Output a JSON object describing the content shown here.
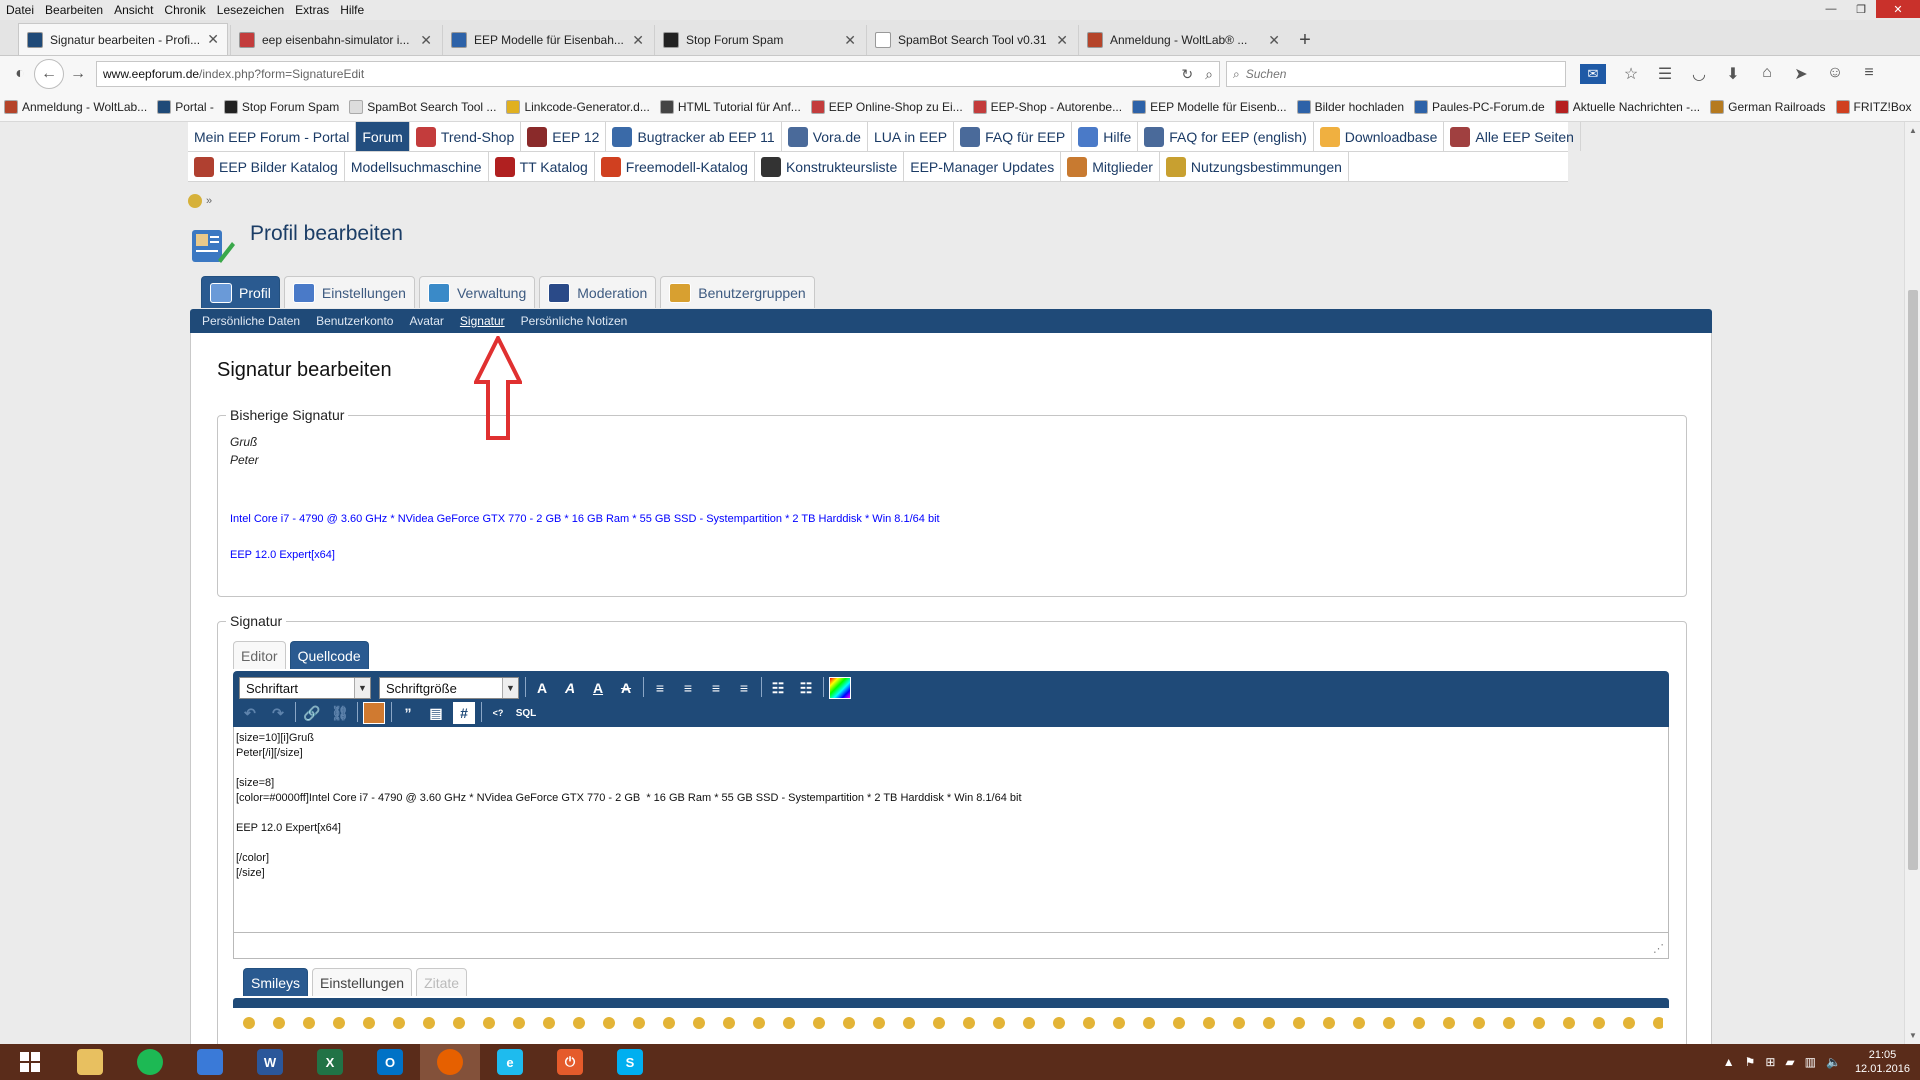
{
  "menubar": [
    "Datei",
    "Bearbeiten",
    "Ansicht",
    "Chronik",
    "Lesezeichen",
    "Extras",
    "Hilfe"
  ],
  "tabs": [
    {
      "title": "Signatur bearbeiten - Profi...",
      "color": "#1f4a78",
      "active": true
    },
    {
      "title": "eep eisenbahn-simulator i...",
      "color": "#c33c3c",
      "active": false
    },
    {
      "title": "EEP Modelle für Eisenbah...",
      "color": "#2d62a8",
      "active": false
    },
    {
      "title": "Stop Forum Spam",
      "color": "#222222",
      "active": false
    },
    {
      "title": "SpamBot Search Tool v0.31",
      "color": "#ffffff",
      "active": false
    },
    {
      "title": "Anmeldung - WoltLab® ...",
      "color": "#b5442a",
      "active": false
    }
  ],
  "url": {
    "host": "www.eepforum.de",
    "path": "/index.php?form=SignatureEdit"
  },
  "search_placeholder": "Suchen",
  "bookmarks": [
    {
      "label": "Anmeldung - WoltLab...",
      "color": "#b5442a"
    },
    {
      "label": "Portal -",
      "color": "#1f4a78"
    },
    {
      "label": "Stop Forum Spam",
      "color": "#222222"
    },
    {
      "label": "SpamBot Search Tool ...",
      "color": "#dddddd"
    },
    {
      "label": "Linkcode-Generator.d...",
      "color": "#e0b020"
    },
    {
      "label": "HTML Tutorial für Anf...",
      "color": "#444444"
    },
    {
      "label": "EEP Online-Shop zu Ei...",
      "color": "#c33c3c"
    },
    {
      "label": "EEP-Shop - Autorenbe...",
      "color": "#c33c3c"
    },
    {
      "label": "EEP Modelle für Eisenb...",
      "color": "#2d62a8"
    },
    {
      "label": "Bilder hochladen",
      "color": "#2d62a8"
    },
    {
      "label": "Paules-PC-Forum.de",
      "color": "#2d62a8"
    },
    {
      "label": "Aktuelle Nachrichten -...",
      "color": "#b52020"
    },
    {
      "label": "German Railroads",
      "color": "#b57a20"
    },
    {
      "label": "FRITZ!Box",
      "color": "#d04020"
    }
  ],
  "forumnav": {
    "row1": [
      {
        "label": "Mein EEP Forum - Portal",
        "icon": "",
        "active": false
      },
      {
        "label": "Forum",
        "icon": "",
        "active": true
      },
      {
        "label": "Trend-Shop",
        "icon": "#c33c3c",
        "active": false
      },
      {
        "label": "EEP 12",
        "icon": "#8a2a2a",
        "active": false
      },
      {
        "label": "Bugtracker ab EEP 11",
        "icon": "#3a6aa8",
        "active": false
      },
      {
        "label": "Vora.de",
        "icon": "#4a6a9a",
        "active": false
      },
      {
        "label": "LUA in EEP",
        "icon": "",
        "active": false
      },
      {
        "label": "FAQ für EEP",
        "icon": "#4a6a9a",
        "active": false
      },
      {
        "label": "Hilfe",
        "icon": "#4a7ac8",
        "active": false
      },
      {
        "label": "FAQ for EEP (english)",
        "icon": "#4a6a9a",
        "active": false
      },
      {
        "label": "Downloadbase",
        "icon": "#f0b040",
        "active": false
      },
      {
        "label": "Alle EEP Seiten",
        "icon": "#a04040",
        "active": false
      }
    ],
    "row2": [
      {
        "label": "EEP Bilder Katalog",
        "icon": "#b04030",
        "active": false
      },
      {
        "label": "Modellsuchmaschine",
        "icon": "",
        "active": false
      },
      {
        "label": "TT Katalog",
        "icon": "#b02020",
        "active": false
      },
      {
        "label": "Freemodell-Katalog",
        "icon": "#d04020",
        "active": false
      },
      {
        "label": "Konstrukteursliste",
        "icon": "#333333",
        "active": false
      },
      {
        "label": "EEP-Manager Updates",
        "icon": "",
        "active": false
      },
      {
        "label": "Mitglieder",
        "icon": "#c87a30",
        "active": false
      },
      {
        "label": "Nutzungsbestimmungen",
        "icon": "#c8a030",
        "active": false
      }
    ]
  },
  "page_title": "Profil bearbeiten",
  "profile_tabs": [
    {
      "label": "Profil",
      "active": true,
      "color": "#6a9ad8"
    },
    {
      "label": "Einstellungen",
      "active": false,
      "color": "#4a7ac8"
    },
    {
      "label": "Verwaltung",
      "active": false,
      "color": "#3a8ac8"
    },
    {
      "label": "Moderation",
      "active": false,
      "color": "#2a4a88"
    },
    {
      "label": "Benutzergruppen",
      "active": false,
      "color": "#d8a030"
    }
  ],
  "subnav": [
    {
      "label": "Persönliche Daten",
      "active": false
    },
    {
      "label": "Benutzerkonto",
      "active": false
    },
    {
      "label": "Avatar",
      "active": false
    },
    {
      "label": "Signatur",
      "active": true
    },
    {
      "label": "Persönliche Notizen",
      "active": false
    }
  ],
  "section_title": "Signatur bearbeiten",
  "prev_signature": {
    "legend": "Bisherige Signatur",
    "line1": "Gruß",
    "line2": "Peter",
    "specs": "Intel Core i7 - 4790 @ 3.60 GHz * NVidea GeForce GTX 770 - 2 GB * 16 GB Ram * 55 GB SSD - Systempartition * 2 TB Harddisk * Win 8.1/64 bit",
    "version": "EEP 12.0 Expert[x64]",
    "text_color": "#0000ff"
  },
  "signature": {
    "legend": "Signatur",
    "editor_tabs": [
      {
        "label": "Editor",
        "active": false
      },
      {
        "label": "Quellcode",
        "active": true
      }
    ],
    "font_select": "Schriftart",
    "size_select": "Schriftgröße",
    "source": "[size=10][i]Gruß\nPeter[/i][/size]\n\n[size=8]\n[color=#0000ff]Intel Core i7 - 4790 @ 3.60 GHz * NVidea GeForce GTX 770 - 2 GB  * 16 GB Ram * 55 GB SSD - Systempartition * 2 TB Harddisk * Win 8.1/64 bit\n\nEEP 12.0 Expert[x64]\n\n[/color]\n[/size]",
    "bottom_tabs": [
      {
        "label": "Smileys",
        "state": "active"
      },
      {
        "label": "Einstellungen",
        "state": "normal"
      },
      {
        "label": "Zitate",
        "state": "disabled"
      }
    ]
  },
  "taskbar": {
    "apps": [
      {
        "name": "explorer",
        "color": "#e8c060",
        "glyph": ""
      },
      {
        "name": "spotify",
        "color": "#1db954",
        "glyph": ""
      },
      {
        "name": "outlook-express",
        "color": "#3a7ad8",
        "glyph": ""
      },
      {
        "name": "word",
        "color": "#2b579a",
        "glyph": "W"
      },
      {
        "name": "excel",
        "color": "#217346",
        "glyph": "X"
      },
      {
        "name": "outlook",
        "color": "#0072c6",
        "glyph": "O"
      },
      {
        "name": "firefox",
        "color": "#e66000",
        "glyph": ""
      },
      {
        "name": "internet-explorer",
        "color": "#1ebbee",
        "glyph": "e"
      },
      {
        "name": "power",
        "color": "#e55b2b",
        "glyph": "⏻"
      },
      {
        "name": "skype",
        "color": "#00aff0",
        "glyph": "S"
      }
    ],
    "time": "21:05",
    "date": "12.01.2016"
  }
}
